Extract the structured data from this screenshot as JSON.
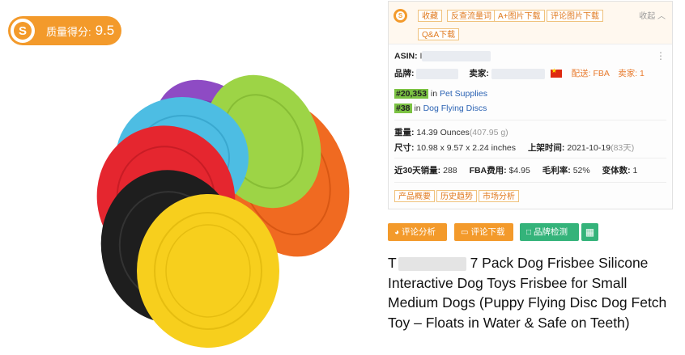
{
  "quality": {
    "label": "质量得分:",
    "score": "9.5",
    "logo": "S"
  },
  "toolbar": {
    "logo": "S",
    "buttons": [
      "收藏",
      "反查流量词",
      "A+图片下载",
      "评论图片下载",
      "Q&A下载"
    ],
    "collapse": "收起"
  },
  "info": {
    "asin_label": "ASIN:",
    "asin_value": "I",
    "brand_label": "品牌:",
    "seller_label": "卖家:",
    "fulfillment": "配送: FBA",
    "seller_count": "卖家: 1",
    "ranks": [
      {
        "rank": "#20,353",
        "in": "in",
        "category": "Pet Supplies"
      },
      {
        "rank": "#38",
        "in": "in",
        "category": "Dog Flying Discs"
      }
    ],
    "weight_label": "重量:",
    "weight_value": "14.39 Ounces",
    "weight_grams": "(407.95 g)",
    "size_label": "尺寸:",
    "size_value": "10.98 x 9.57 x 2.24 inches",
    "listed_label": "上架时间:",
    "listed_value": "2021-10-19",
    "listed_days": "(83天)",
    "sales_label": "近30天销量:",
    "sales_value": "288",
    "fba_label": "FBA费用:",
    "fba_value": "$4.95",
    "margin_label": "毛利率:",
    "margin_value": "52%",
    "variants_label": "变体数:",
    "variants_value": "1"
  },
  "analysis_buttons": [
    "产品概要",
    "历史趋势",
    "市场分析"
  ],
  "actions": [
    {
      "label": "评论分析",
      "color": "#f39a2b",
      "icon": "pie-chart-icon"
    },
    {
      "label": "评论下载",
      "color": "#f39a2b",
      "icon": "message-icon"
    },
    {
      "label": "品牌检测",
      "color": "#34b37a",
      "icon": "square-icon"
    },
    {
      "icon": "calculator-icon",
      "color": "#34b37a"
    }
  ],
  "product": {
    "title_prefix": "T",
    "title": "7 Pack Dog Frisbee Silicone Interactive Dog Toys Frisbee for Small Medium Dogs (Puppy Flying Disc Dog Fetch Toy – Floats in Water & Safe on Teeth)",
    "disc_colors": [
      "#8e4bc4",
      "#9dd446",
      "#4dbde3",
      "#f06a21",
      "#e5262f",
      "#1e1e1e",
      "#f7cf1d"
    ]
  }
}
